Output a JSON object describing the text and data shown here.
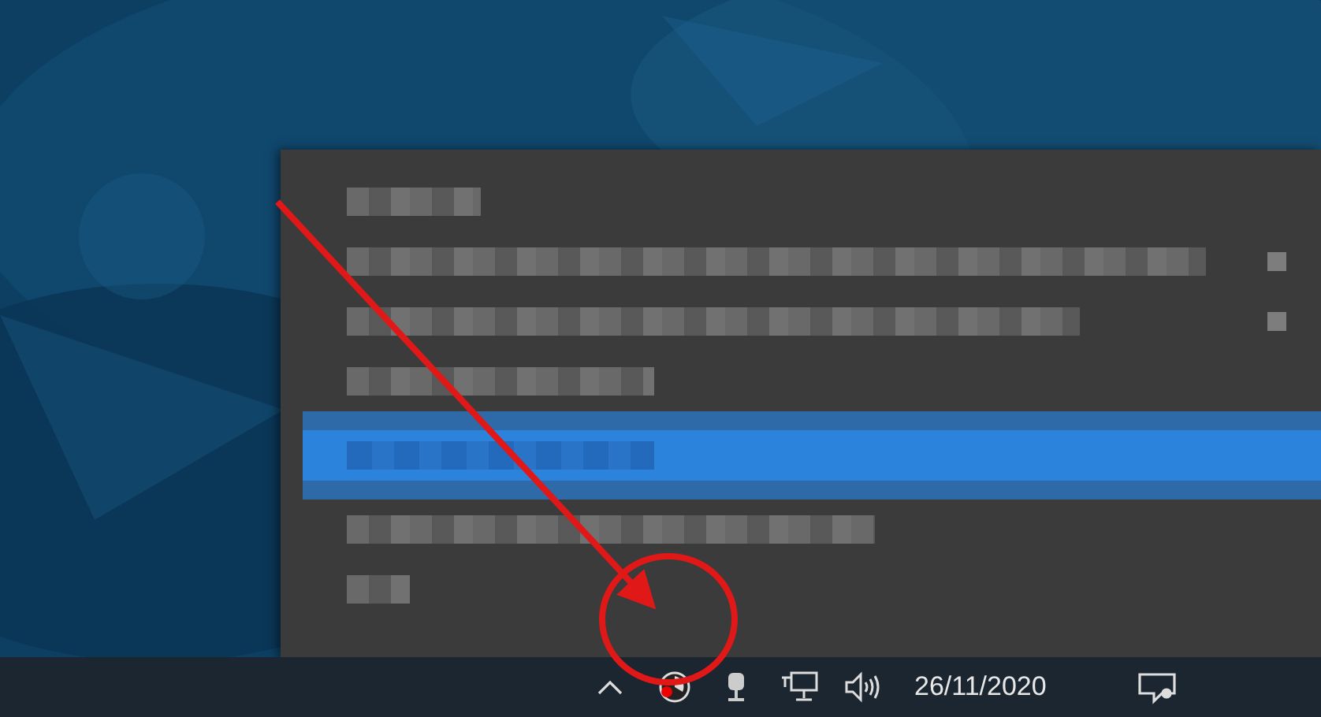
{
  "context_menu": {
    "items": [
      {
        "selected": false,
        "submenu": false
      },
      {
        "selected": false,
        "submenu": true
      },
      {
        "selected": false,
        "submenu": true
      },
      {
        "selected": false,
        "submenu": false
      },
      {
        "selected": true,
        "submenu": false
      },
      {
        "selected": false,
        "submenu": false
      },
      {
        "selected": false,
        "submenu": false
      }
    ]
  },
  "taskbar": {
    "date": "26/11/2020"
  }
}
